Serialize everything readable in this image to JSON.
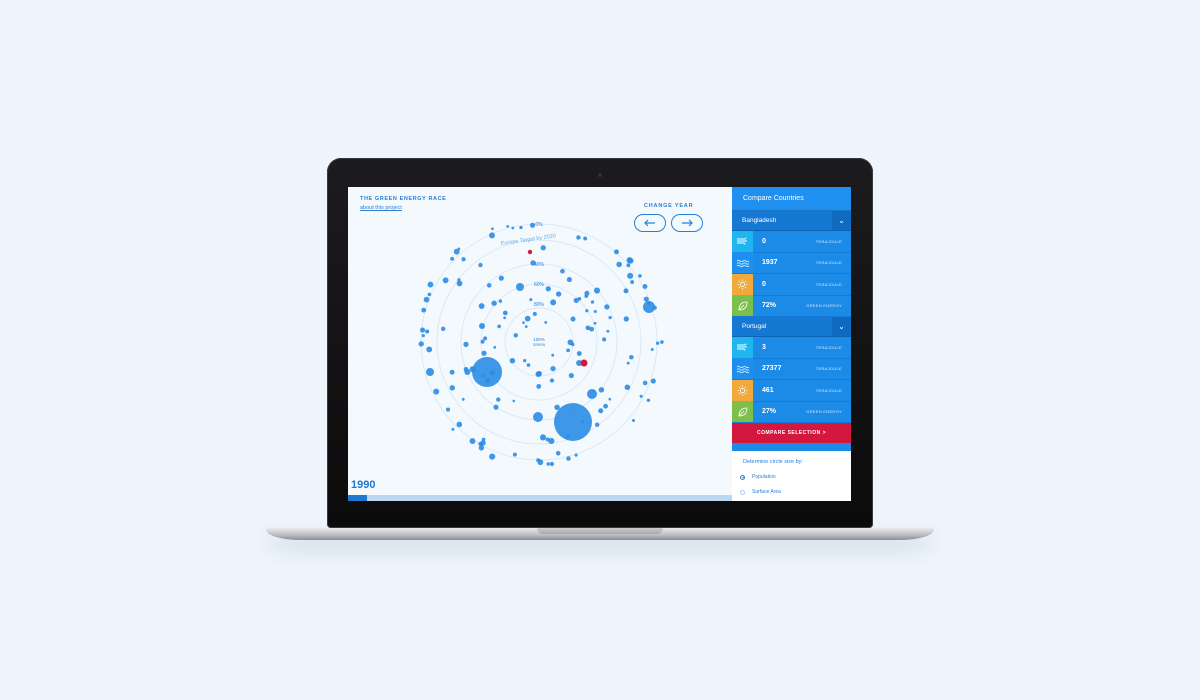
{
  "app": {
    "title": "THE GREEN ENERGY RACE",
    "about_link": "about this project",
    "change_year_label": "CHANGE YEAR",
    "prev_icon": "arrow-left-icon",
    "next_icon": "arrow-right-icon",
    "year": "1990",
    "timeline_progress": 0.05
  },
  "chart": {
    "ring_labels": [
      "0%",
      "40%",
      "60%",
      "80%"
    ],
    "center_label_top": "100%",
    "center_label_bottom": "GREEN",
    "target_label": "Europe Target by 2020",
    "colors": {
      "bubble": "#2b8ce6",
      "highlight": "#d4173f",
      "ring": "#d9e9f8"
    }
  },
  "sidebar": {
    "title": "Compare Countries",
    "countries": [
      {
        "name": "Bangladesh",
        "stats": [
          {
            "icon": "wind-icon",
            "color": "#1fb6f0",
            "value": "0",
            "unit": "TERAJOULE"
          },
          {
            "icon": "water-icon",
            "color": "#1d8fee",
            "value": "1937",
            "unit": "TERAJOULE"
          },
          {
            "icon": "sun-icon",
            "color": "#f2a93b",
            "value": "0",
            "unit": "TERAJOULE"
          },
          {
            "icon": "leaf-icon",
            "color": "#7cc04b",
            "value": "72%",
            "unit": "GREEN ENERGY"
          }
        ]
      },
      {
        "name": "Portugal",
        "stats": [
          {
            "icon": "wind-icon",
            "color": "#1fb6f0",
            "value": "3",
            "unit": "TERAJOULE"
          },
          {
            "icon": "water-icon",
            "color": "#1d8fee",
            "value": "27377",
            "unit": "TERAJOULE"
          },
          {
            "icon": "sun-icon",
            "color": "#f2a93b",
            "value": "461",
            "unit": "TERAJOULE"
          },
          {
            "icon": "leaf-icon",
            "color": "#7cc04b",
            "value": "27%",
            "unit": "GREEN ENERGY"
          }
        ]
      }
    ],
    "compare_button": "COMPARE SELECTION  >",
    "circle_size_title": "Determine circle size by:",
    "options": [
      {
        "label": "Population",
        "selected": true
      },
      {
        "label": "Surface Area",
        "selected": false
      }
    ]
  }
}
